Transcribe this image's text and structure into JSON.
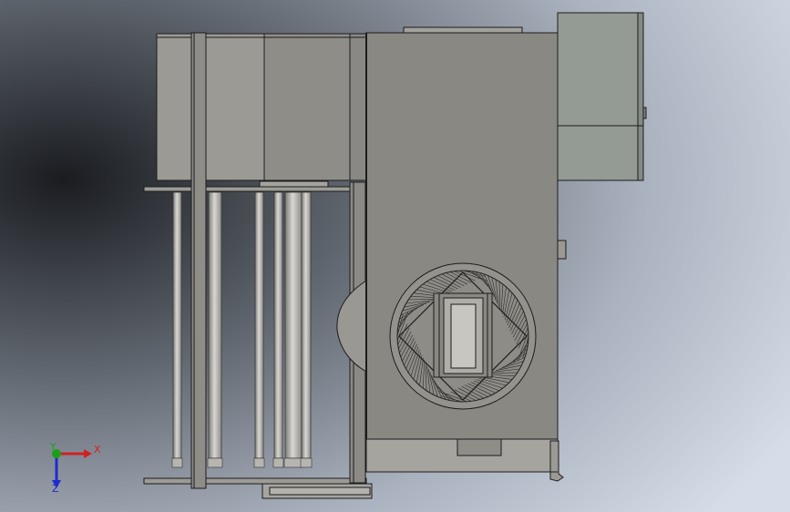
{
  "triad": {
    "x_label": "X",
    "y_label": "Y",
    "z_label": "Z",
    "x_color": "#d22020",
    "y_color": "#19a019",
    "z_color": "#1f2ad0"
  },
  "colors": {
    "background_dark": "#1c1e22",
    "background_light": "#d3dbe6",
    "steel": "#8c8a84",
    "steel_light": "#a4a29c",
    "edge": "#1c1c1c"
  }
}
